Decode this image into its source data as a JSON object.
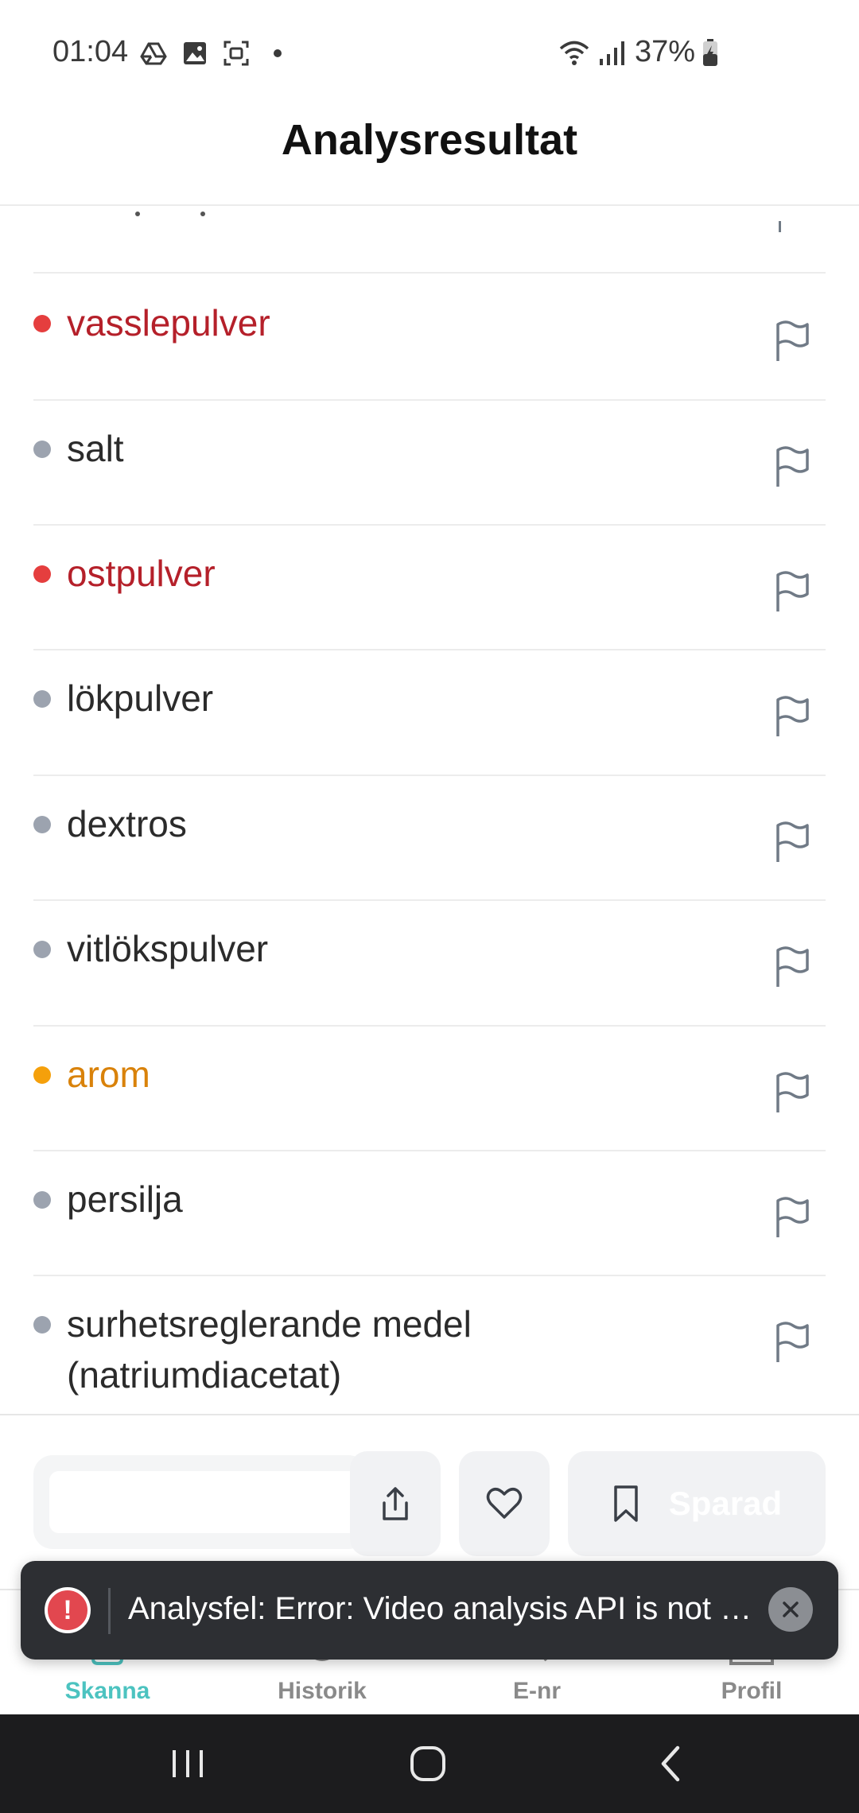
{
  "status_bar": {
    "time": "01:04",
    "battery": "37%",
    "icons": [
      "drive-icon",
      "image-icon",
      "screen-capture-icon",
      "wifi-icon",
      "signal-icon",
      "battery-icon"
    ]
  },
  "header": {
    "title": "Analysresultat"
  },
  "ingredients": [
    {
      "name": "vasslepulver",
      "status": "red"
    },
    {
      "name": "salt",
      "status": "grey"
    },
    {
      "name": "ostpulver",
      "status": "red"
    },
    {
      "name": "lökpulver",
      "status": "grey"
    },
    {
      "name": "dextros",
      "status": "grey"
    },
    {
      "name": "vitlökspulver",
      "status": "grey"
    },
    {
      "name": "arom",
      "status": "orange"
    },
    {
      "name": "persilja",
      "status": "grey"
    },
    {
      "name_line1": "surhetsreglerande medel",
      "name_line2": "(natriumdiacetat)",
      "status": "grey"
    }
  ],
  "actions": {
    "save_label": "Sparad"
  },
  "nav": {
    "scan": "Skanna",
    "history": "Historik",
    "enr": "E-nr",
    "profile": "Profil"
  },
  "toast": {
    "message": "Analysfel: Error: Video analysis API is not …"
  },
  "colors": {
    "red": "#e53e3e",
    "grey": "#9ca3af",
    "orange": "#f5a00b",
    "accent": "#4cc3c0"
  }
}
